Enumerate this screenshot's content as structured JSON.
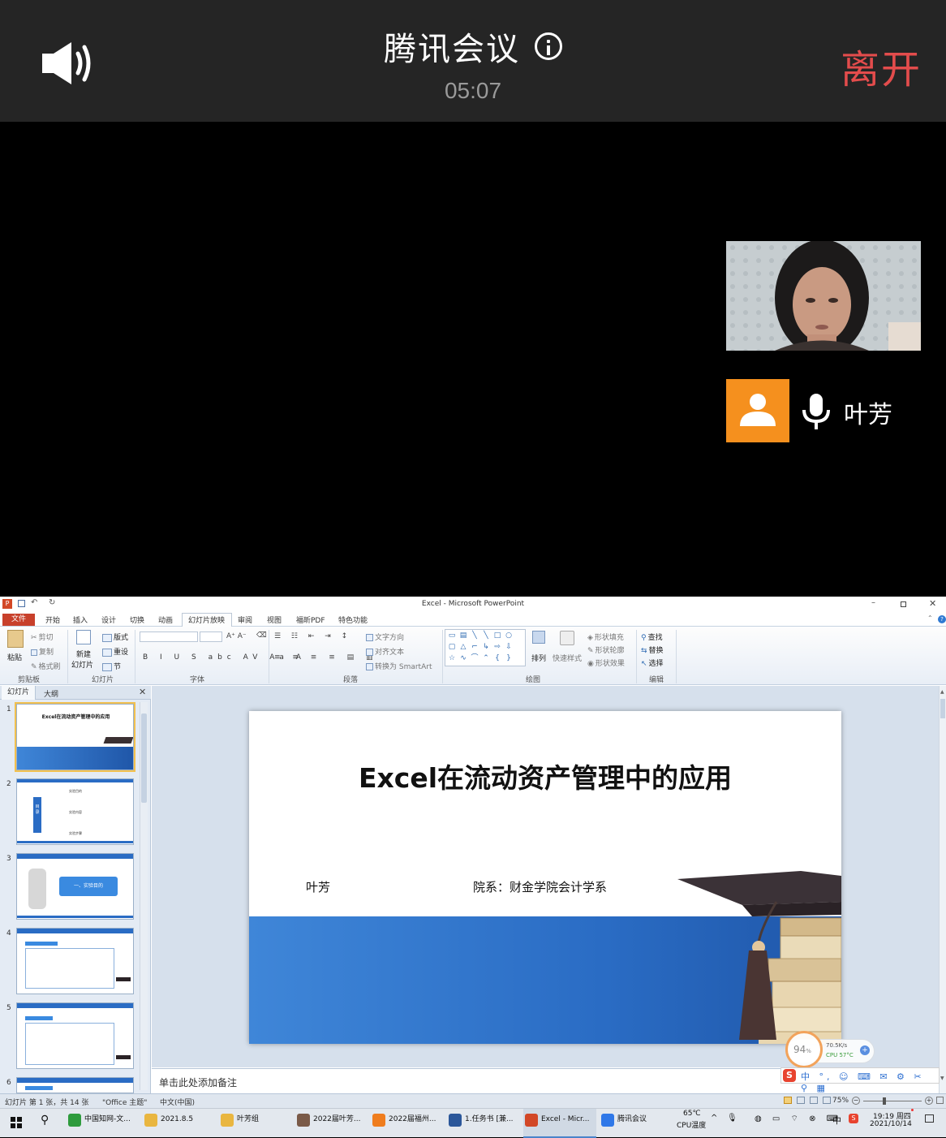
{
  "meeting": {
    "title": "腾讯会议",
    "timer": "05:07",
    "leave_label": "离开",
    "participant_name": "叶芳"
  },
  "ppt": {
    "window_title": "Excel - Microsoft PowerPoint",
    "tabs": {
      "file": "文件",
      "home": "开始",
      "insert": "插入",
      "design": "设计",
      "transitions": "切换",
      "animations": "动画",
      "slideshow": "幻灯片放映",
      "review": "审阅",
      "view": "视图",
      "pdf": "福昕PDF",
      "special": "特色功能"
    },
    "ribbon": {
      "paste": "粘贴",
      "cut": "剪切",
      "copy": "复制",
      "format_painter": "格式刷",
      "new_slide_1": "新建",
      "new_slide_2": "幻灯片",
      "layout": "版式",
      "reset": "重设",
      "section": "节",
      "text_direction": "文字方向",
      "align_text": "对齐文本",
      "smartart": "转换为 SmartArt",
      "arrange": "排列",
      "quick_styles": "快速样式",
      "shape_fill": "形状填充",
      "shape_outline": "形状轮廓",
      "shape_effects": "形状效果",
      "find": "查找",
      "replace": "替换",
      "select": "选择",
      "groups": {
        "clipboard": "剪贴板",
        "slides": "幻灯片",
        "font": "字体",
        "paragraph": "段落",
        "drawing": "绘图",
        "editing": "编辑"
      }
    },
    "panel_tabs": {
      "slides": "幻灯片",
      "outline": "大纲"
    },
    "thumbnails": [
      {
        "num": "1",
        "title": "Excel在流动资产管理中的应用"
      },
      {
        "num": "2",
        "items": [
          "实验目的",
          "实验内容",
          "实验步骤"
        ]
      },
      {
        "num": "3",
        "label": "一、实验目的"
      },
      {
        "num": "4"
      },
      {
        "num": "5"
      },
      {
        "num": "6"
      }
    ],
    "slide": {
      "title": "Excel在流动资产管理中的应用",
      "author": "叶芳",
      "department": "院系：财金学院会计学系"
    },
    "notes_placeholder": "单击此处添加备注",
    "status": {
      "slide_info": "幻灯片 第 1 张，共 14 张",
      "theme": "\"Office 主题\"",
      "language": "中文(中国)",
      "zoom": "75%"
    },
    "cpu_widget": {
      "percent": "94",
      "unit": "%",
      "speed": "70.5K/s",
      "cpu_temp": "CPU 57°C"
    }
  },
  "taskbar": {
    "items": [
      {
        "label": "中国知网-文...",
        "color": "#2e9b3d"
      },
      {
        "label": "2021.8.5",
        "color": "#e9b640"
      },
      {
        "label": "叶芳组",
        "color": "#e9b640"
      },
      {
        "label": "2022届叶芳...",
        "color": "#7a5a48"
      },
      {
        "label": "2022届福州...",
        "color": "#ef7d1e"
      },
      {
        "label": "1.任务书 [兼...",
        "color": "#2b579a"
      },
      {
        "label": "Excel - Micr...",
        "color": "#d24726"
      },
      {
        "label": "腾讯会议",
        "color": "#2f78e8"
      }
    ],
    "weather_temp": "65℃",
    "weather_label": "CPU温度",
    "ime": "中",
    "time": "19:19 周四",
    "date": "2021/10/14"
  }
}
